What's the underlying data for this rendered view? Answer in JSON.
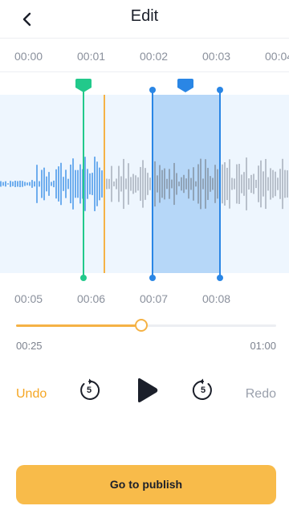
{
  "header": {
    "title": "Edit"
  },
  "timeline_top": [
    "00:00",
    "00:01",
    "00:02",
    "00:03",
    "00:04"
  ],
  "timeline_bottom": [
    "00:05",
    "00:06",
    "00:07",
    "00:08"
  ],
  "playback": {
    "current_time": "00:25",
    "total_time": "01:00",
    "progress": 0.48
  },
  "controls": {
    "undo_label": "Undo",
    "redo_label": "Redo",
    "rewind_seconds": "5",
    "forward_seconds": "5"
  },
  "publish_label": "Go to publish",
  "colors": {
    "accent": "#f5b245",
    "publish_bg": "#f8bb4a",
    "selection": "#b6d7f8",
    "wave_active": "#2a86e5",
    "wave_inactive": "#9aa3b0",
    "start_marker": "#22c98b",
    "playhead": "#f5b245"
  }
}
